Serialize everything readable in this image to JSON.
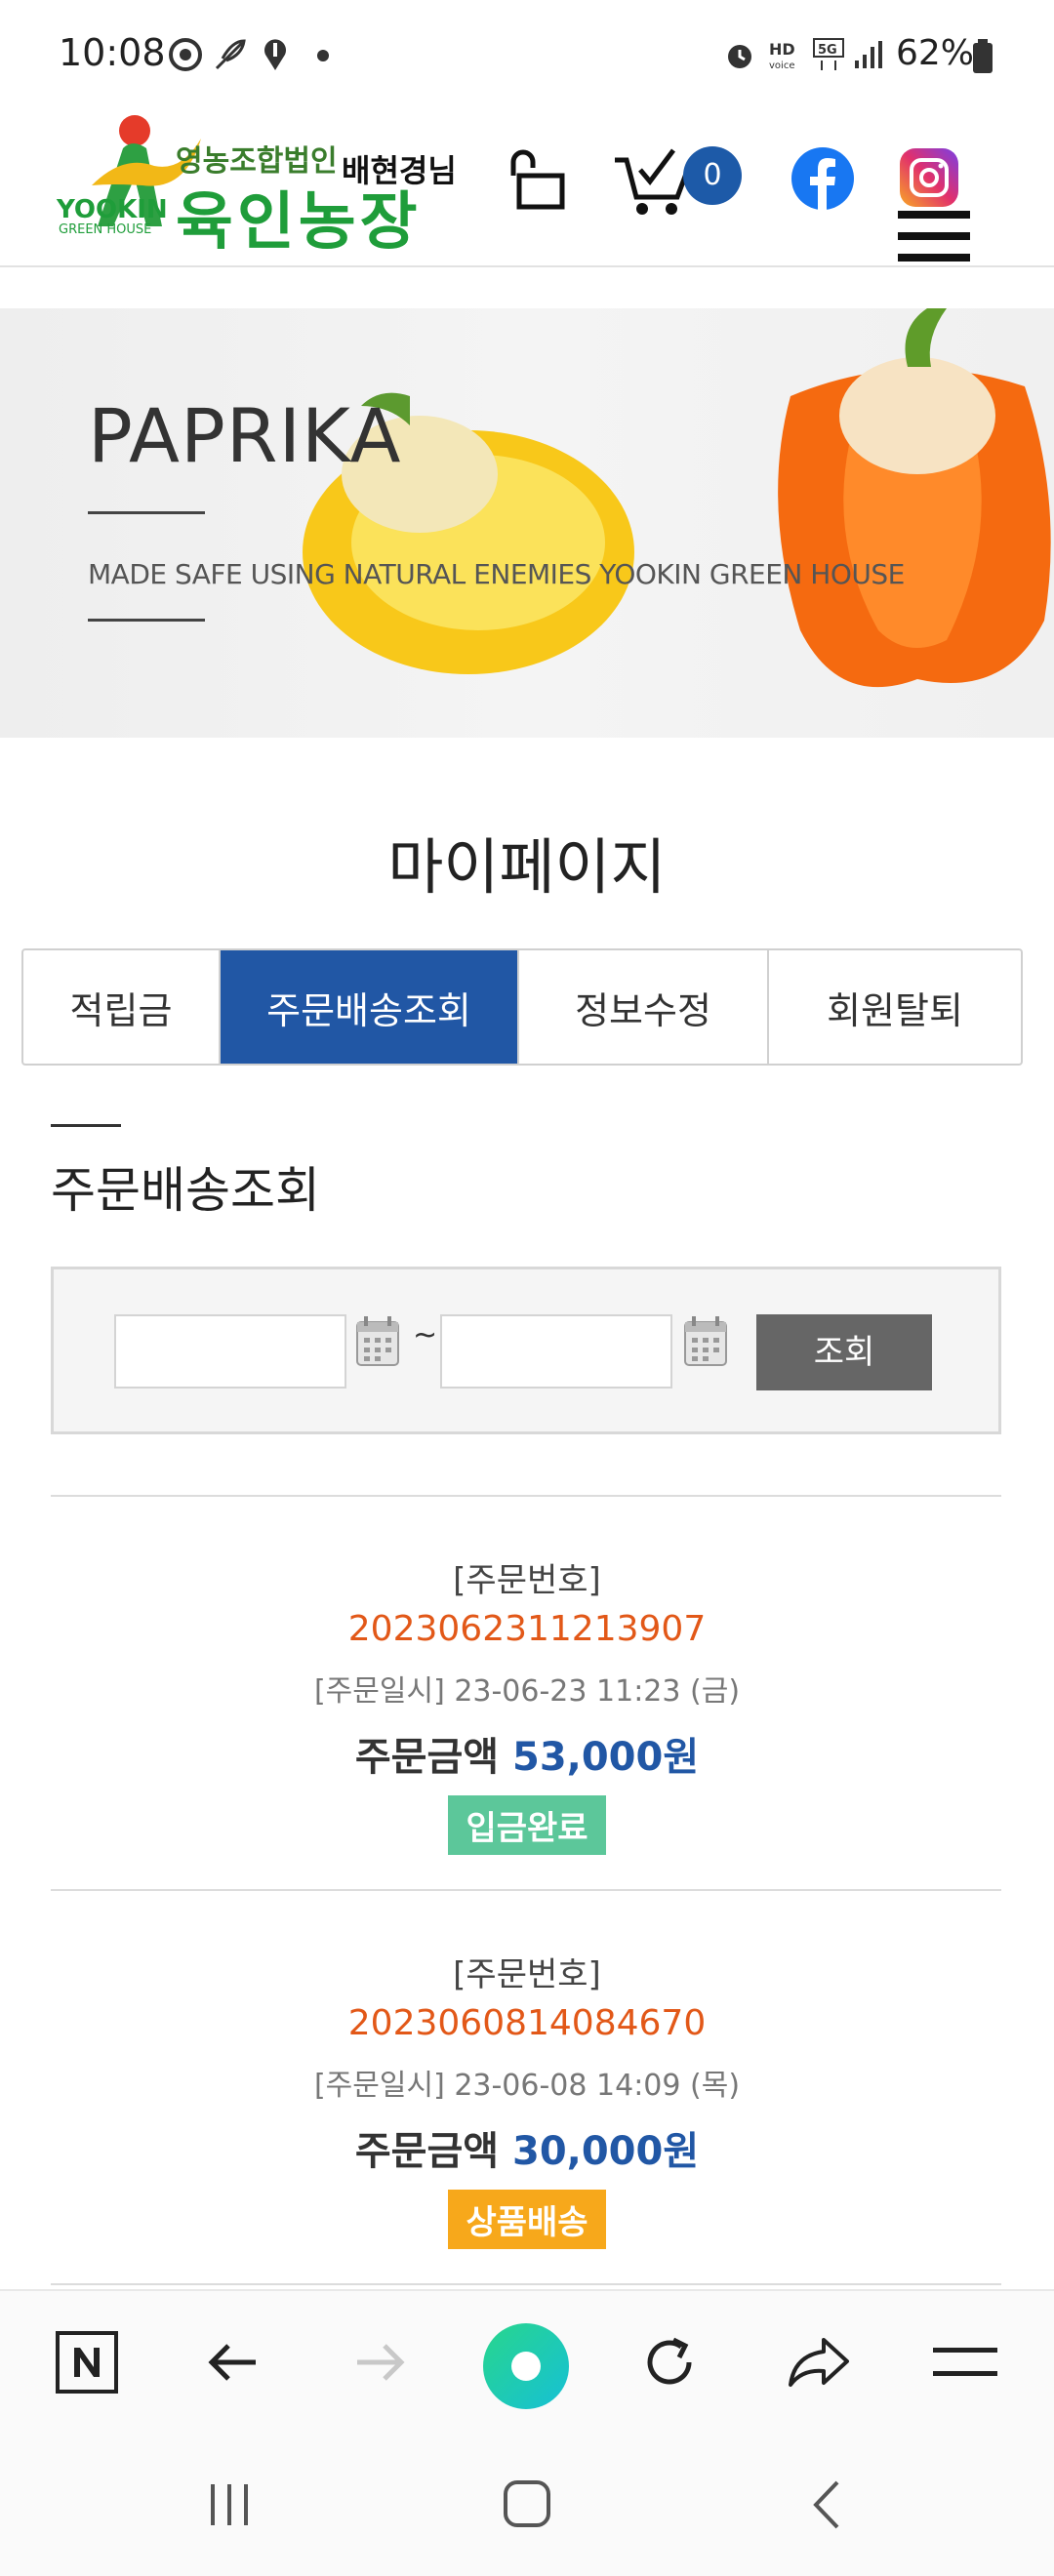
{
  "status_bar": {
    "time": "10:08",
    "battery": "62%",
    "icons": [
      "chrome-icon",
      "feather-icon",
      "location-icon",
      "dot-icon",
      "alarm-icon",
      "hd-voice-icon",
      "5g-icon",
      "signal-icon",
      "battery-icon"
    ]
  },
  "header": {
    "logo_sub": "영농조합법인",
    "logo_main": "육인농장",
    "logo_en": "YOOKIN",
    "logo_en_sub": "GREEN HOUSE",
    "user_name": "배현경님",
    "cart_count": "0"
  },
  "banner": {
    "title": "PAPRIKA",
    "subtitle": "MADE SAFE USING NATURAL ENEMIES YOOKIN GREEN HOUSE"
  },
  "page_title": "마이페이지",
  "tabs": [
    {
      "label": "적립금",
      "active": false
    },
    {
      "label": "주문배송조회",
      "active": true
    },
    {
      "label": "정보수정",
      "active": false
    },
    {
      "label": "회원탈퇴",
      "active": false
    }
  ],
  "section_title": "주문배송조회",
  "search": {
    "start_value": "",
    "end_value": "",
    "separator": "~",
    "button_label": "조회"
  },
  "orders": [
    {
      "label": "[주문번호]",
      "number": "2023062311213907",
      "date": "[주문일시] 23-06-23 11:23 (금)",
      "amount_label": "주문금액",
      "amount": "53,000원",
      "status": "입금완료",
      "status_color": "#5cc79a"
    },
    {
      "label": "[주문번호]",
      "number": "2023060814084670",
      "date": "[주문일시] 23-06-08 14:09 (목)",
      "amount_label": "주문금액",
      "amount": "30,000원",
      "status": "상품배송",
      "status_color": "#f7a81b"
    }
  ],
  "colors": {
    "accent": "#2157a5",
    "order_number": "#e25818"
  }
}
